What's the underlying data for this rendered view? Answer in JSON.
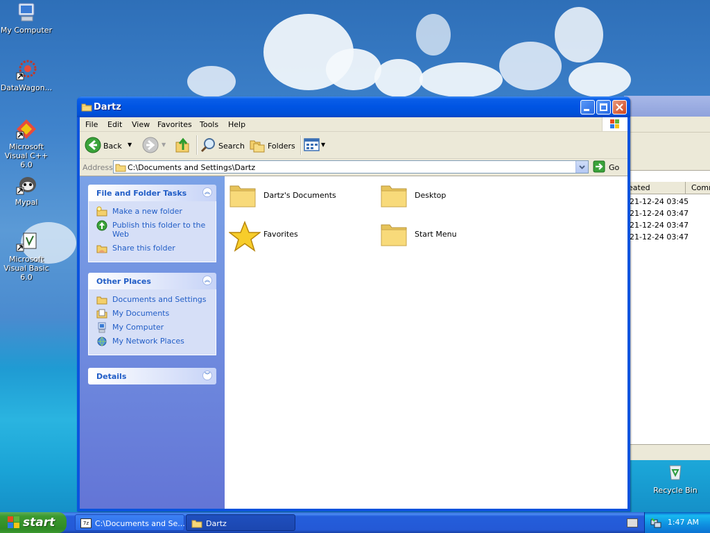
{
  "colors": {
    "title_blue": "#0054e3",
    "task_link": "#215dc6",
    "start_green": "#3c9a2f",
    "window_bg": "#ece9d8"
  },
  "desktop": {
    "icons": [
      {
        "label": "My Computer",
        "icon": "computer-icon"
      },
      {
        "label": "DataWagon...",
        "icon": "datawagon-icon"
      },
      {
        "label": "Microsoft Visual C++ 6.0",
        "icon": "visual-cpp-icon"
      },
      {
        "label": "Mypal",
        "icon": "mypal-icon"
      },
      {
        "label": "Microsoft Visual Basic 6.0",
        "icon": "visual-basic-icon"
      },
      {
        "label": "Recycle Bin",
        "icon": "recycle-bin-icon"
      }
    ]
  },
  "background_window": {
    "column_created": "eated",
    "column_comments": "Comm",
    "rows": [
      "21-12-24 03:45",
      "21-12-24 03:47",
      "21-12-24 03:47",
      "21-12-24 03:47"
    ]
  },
  "window": {
    "title": "Dartz",
    "menu": [
      "File",
      "Edit",
      "View",
      "Favorites",
      "Tools",
      "Help"
    ],
    "toolbar": {
      "back": "Back",
      "search": "Search",
      "folders": "Folders"
    },
    "address": {
      "label": "Address",
      "value": "C:\\Documents and Settings\\Dartz",
      "go": "Go"
    },
    "tasks": {
      "title": "File and Folder Tasks",
      "items": [
        "Make a new folder",
        "Publish this folder to the Web",
        "Share this folder"
      ]
    },
    "other_places": {
      "title": "Other Places",
      "items": [
        "Documents and Settings",
        "My Documents",
        "My Computer",
        "My Network Places"
      ]
    },
    "details": {
      "title": "Details"
    },
    "items": [
      {
        "label": "Dartz's Documents",
        "icon": "folder-icon"
      },
      {
        "label": "Desktop",
        "icon": "folder-icon"
      },
      {
        "label": "Favorites",
        "icon": "favorites-star-icon"
      },
      {
        "label": "Start Menu",
        "icon": "folder-icon"
      }
    ]
  },
  "taskbar": {
    "start": "start",
    "buttons": [
      "C:\\Documents and Se...",
      "Dartz"
    ],
    "clock": "1:47 AM"
  }
}
